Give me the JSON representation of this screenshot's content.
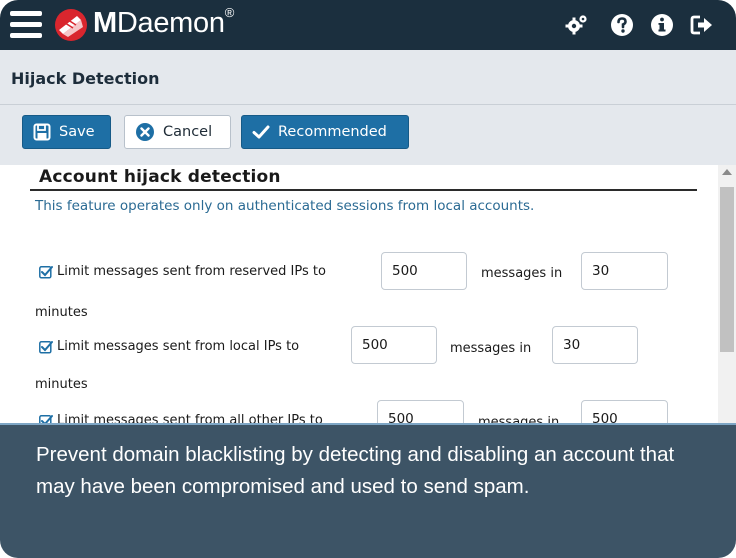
{
  "app": {
    "brand_prefix": "M",
    "brand_name": "Daemon",
    "brand_mark": "®",
    "accent_color": "#1e6fa5",
    "topbar_color": "#1b2f3e",
    "logo_color": "#d9262e"
  },
  "topbar": {
    "icons": [
      "menu-icon",
      "settings-icon",
      "help-icon",
      "info-icon",
      "logout-icon"
    ]
  },
  "page": {
    "title": "Hijack Detection"
  },
  "toolbar": {
    "save_label": "Save",
    "cancel_label": "Cancel",
    "recommended_label": "Recommended"
  },
  "section": {
    "title": "Account hijack detection",
    "description": "This feature operates only on authenticated sessions from local accounts."
  },
  "rules": [
    {
      "label": "Limit messages sent from reserved IPs to",
      "count": "500",
      "middle": "messages in",
      "minutes": "30",
      "unit": "minutes",
      "checked": true
    },
    {
      "label": "Limit messages sent from local IPs to",
      "count": "500",
      "middle": "messages in",
      "minutes": "30",
      "unit": "minutes",
      "checked": true
    },
    {
      "label": "Limit messages sent from all other IPs to",
      "count": "500",
      "middle": "messages in",
      "minutes": "500",
      "checked": true
    }
  ],
  "caption": {
    "text": "Prevent domain blacklisting by detecting and disabling an account that may have been compromised and used to send spam."
  }
}
